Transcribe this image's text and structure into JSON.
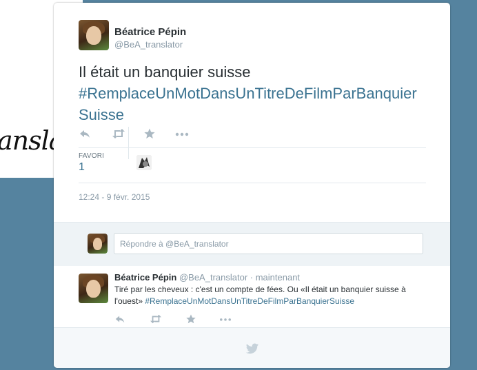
{
  "background": {
    "script_text": "ansla"
  },
  "tweet": {
    "author_name": "Béatrice Pépin",
    "author_handle": "@BeA_translator",
    "text_plain": "Il était un banquier suisse",
    "hashtag": "#RemplaceUnMotDansUnTitreDeFilmParBanquierSuisse",
    "actions": [
      "reply-icon",
      "retweet-icon",
      "favorite-icon",
      "more-icon"
    ],
    "favorites_label": "FAVORI",
    "favorites_count": "1",
    "timestamp": "12:24 - 9 févr. 2015"
  },
  "reply_box": {
    "placeholder": "Répondre à @BeA_translator"
  },
  "reply_tweet": {
    "author_name": "Béatrice Pépin",
    "author_handle": "@BeA_translator",
    "separator": " · ",
    "time": "maintenant",
    "text": "Tiré par les cheveux : c'est un compte de fées. Ou «Il était un banquier suisse à l'ouest»",
    "hashtag": "#RemplaceUnMotDansUnTitreDeFilmParBanquierSuisse"
  },
  "colors": {
    "page_background": "#55839f",
    "hashtag": "#3b7391",
    "muted": "#8899a6",
    "icon": "#aab8c2"
  }
}
